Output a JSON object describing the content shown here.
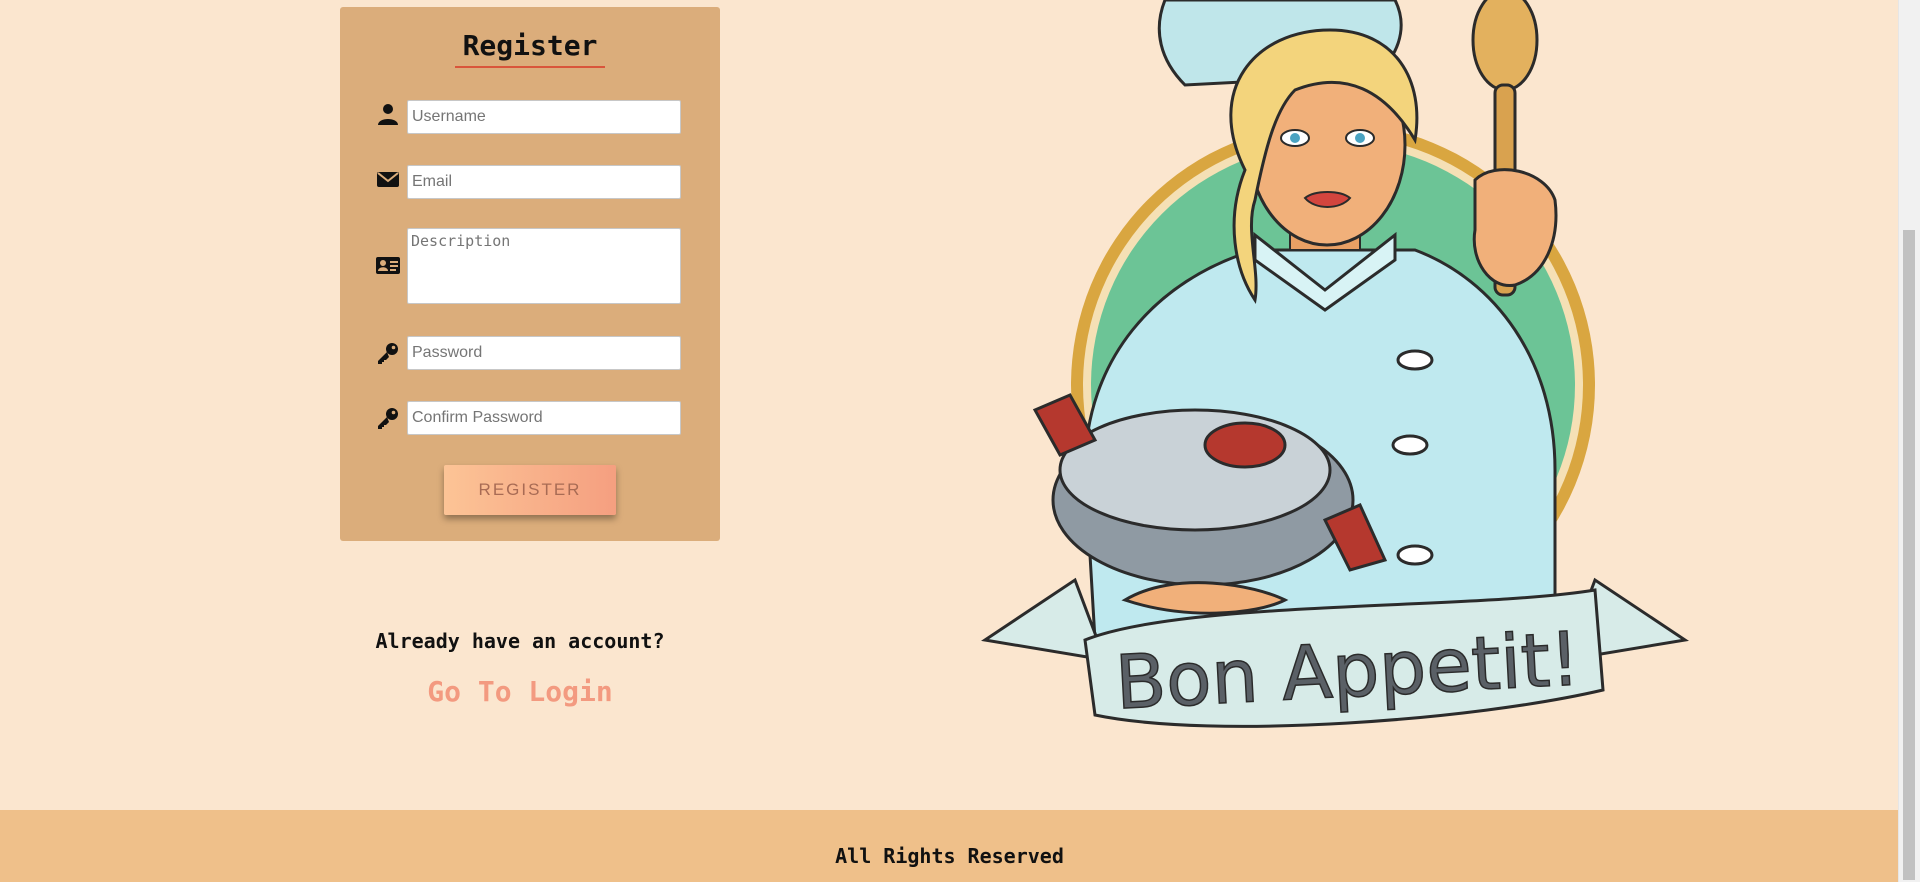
{
  "register": {
    "title": "Register",
    "fields": {
      "username_placeholder": "Username",
      "email_placeholder": "Email",
      "description_placeholder": "Description",
      "password_placeholder": "Password",
      "confirm_password_placeholder": "Confirm Password"
    },
    "button_label": "REGISTER"
  },
  "login_prompt": {
    "text": "Already have an account?",
    "link_label": "Go To Login"
  },
  "hero": {
    "banner_text": "Bon Appetit!"
  },
  "footer": {
    "text": "All Rights Reserved"
  },
  "icons": [
    "user-icon",
    "envelope-icon",
    "id-card-icon",
    "key-icon",
    "key-icon"
  ],
  "colors": {
    "page_background": "#fbe6cf",
    "card_background": "#dbad7b",
    "accent": "#f39a80",
    "title_underline": "#d9553b",
    "footer_background": "#efc08a"
  }
}
